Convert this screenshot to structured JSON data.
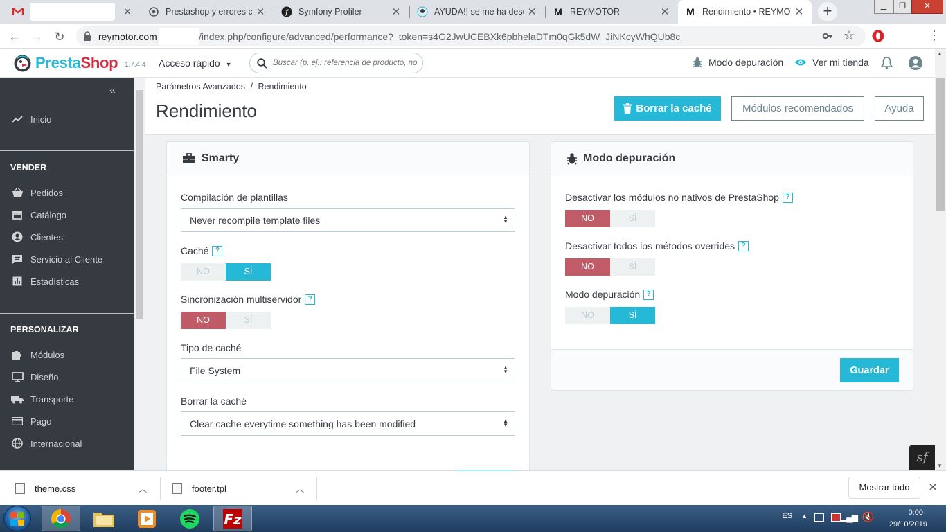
{
  "browser": {
    "tabs": [
      {
        "title": "",
        "icon": "gmail-icon"
      },
      {
        "title": "Prestashop y errores con",
        "icon": "prestashop-icon"
      },
      {
        "title": "Symfony Profiler",
        "icon": "symfony-icon"
      },
      {
        "title": "AYUDA!! se me ha desco",
        "icon": "prestashop-icon"
      },
      {
        "title": "REYMOTOR",
        "icon": "reymotor-icon"
      },
      {
        "title": "Rendimiento • REYMOTO",
        "icon": "reymotor-icon"
      }
    ],
    "url_host": "reymotor.com",
    "url_path": "/index.php/configure/advanced/performance?_token=s4G2JwUCEBXk6pbhelaDTm0qGk5dW_JiNKcyWhQUb8c"
  },
  "header": {
    "logo_presta": "Presta",
    "logo_shop": "Shop",
    "version": "1.7.4.4",
    "quick_access": "Acceso rápido",
    "search_placeholder": "Buscar (p. ej.: referencia de producto, no",
    "debug_mode": "Modo depuración",
    "view_store": "Ver mi tienda"
  },
  "sidebar": {
    "home": "Inicio",
    "section_sell": "VENDER",
    "sell_items": [
      "Pedidos",
      "Catálogo",
      "Clientes",
      "Servicio al Cliente",
      "Estadísticas"
    ],
    "section_customize": "PERSONALIZAR",
    "customize_items": [
      "Módulos",
      "Diseño",
      "Transporte",
      "Pago",
      "Internacional"
    ]
  },
  "toolbar": {
    "breadcrumb_parent": "Parámetros Avanzados",
    "breadcrumb_sep": "/",
    "breadcrumb_current": "Rendimiento",
    "title": "Rendimiento",
    "clear_cache": "Borrar la caché",
    "recommended_modules": "Módulos recomendados",
    "help": "Ayuda"
  },
  "smarty": {
    "title": "Smarty",
    "template_compilation_label": "Compilación de plantillas",
    "template_compilation_value": "Never recompile template files",
    "cache_label": "Caché",
    "cache_value": "SÍ",
    "multiserver_label": "Sincronización multiservidor",
    "multiserver_value": "NO",
    "cache_type_label": "Tipo de caché",
    "cache_type_value": "File System",
    "clear_cache_label": "Borrar la caché",
    "clear_cache_value": "Clear cache everytime something has been modified"
  },
  "debug": {
    "title": "Modo depuración",
    "disable_nonnative_label": "Desactivar los módulos no nativos de PrestaShop",
    "disable_nonnative_value": "NO",
    "disable_overrides_label": "Desactivar todos los métodos overrides",
    "disable_overrides_value": "NO",
    "debug_mode_label": "Modo depuración",
    "debug_mode_value": "SÍ",
    "save": "Guardar"
  },
  "switch": {
    "no": "NO",
    "yes": "SÍ"
  },
  "help_glyph": "?",
  "downloads": {
    "items": [
      "theme.css",
      "footer.tpl"
    ],
    "show_all": "Mostrar todo"
  },
  "taskbar": {
    "lang": "ES",
    "time": "0:00",
    "date": "29/10/2019"
  },
  "colors": {
    "accent": "#25b9d7",
    "danger": "#c05c67",
    "sidebar": "#363a41"
  }
}
